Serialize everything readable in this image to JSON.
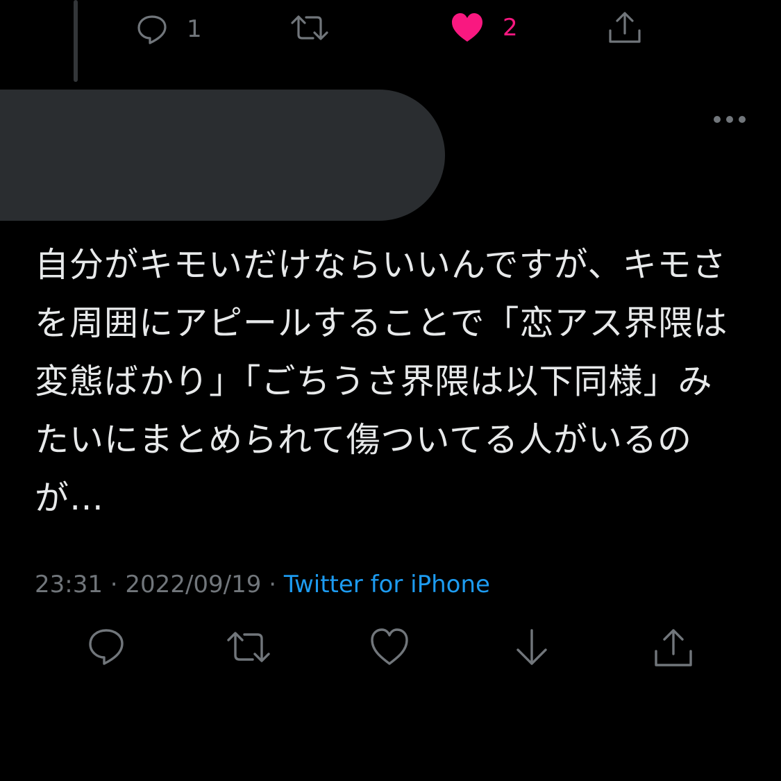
{
  "previous_tweet": {
    "actions": {
      "reply_count": "1",
      "like_count": "2"
    }
  },
  "tweet": {
    "text": "自分がキモいだけならいいんですが、キモさを周囲にアピールすることで「恋アス界隈は変態ばかり」「ごちうさ界隈は以下同様」みたいにまとめられて傷ついてる人がいるのが…",
    "time": "23:31",
    "separator": "·",
    "date": "2022/09/19",
    "source": "Twitter for iPhone"
  },
  "icons": {
    "reply": "reply-icon",
    "retweet": "retweet-icon",
    "like": "heart-icon",
    "like_filled": "heart-filled-icon",
    "bookmark": "bookmark-download-icon",
    "share": "share-icon",
    "more": "more-icon"
  },
  "colors": {
    "background": "#000000",
    "text": "#e7e9ea",
    "muted": "#71767b",
    "link": "#1d9bf0",
    "like": "#f91880",
    "redacted": "#2a2d30"
  }
}
